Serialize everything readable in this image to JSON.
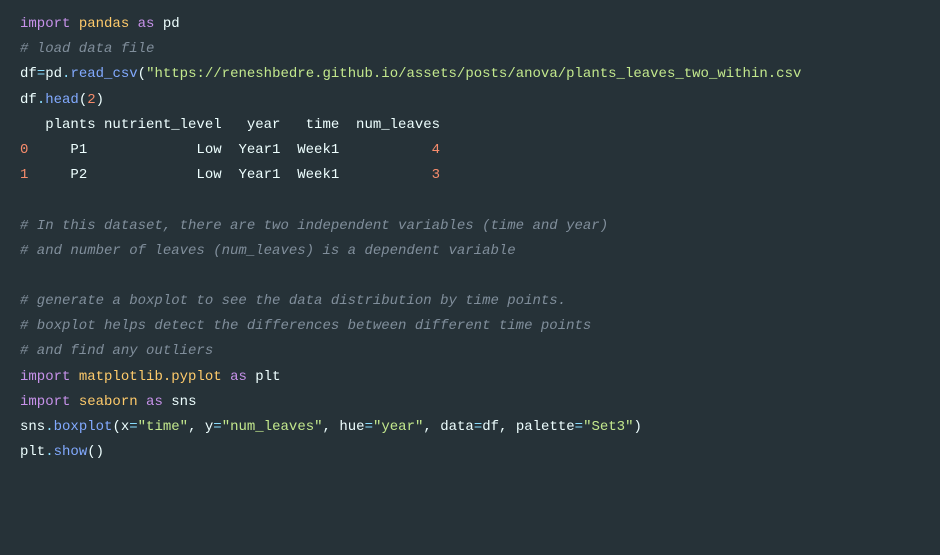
{
  "code": {
    "l1_import": "import",
    "l1_mod": "pandas",
    "l1_as": "as",
    "l1_alias": "pd",
    "l2_comment": "# load data file",
    "l3_var": "df",
    "l3_eq": "=",
    "l3_pd": "pd",
    "l3_dot": ".",
    "l3_fn": "read_csv",
    "l3_lp": "(",
    "l3_url": "\"https://reneshbedre.github.io/assets/posts/anova/plants_leaves_two_within.csv",
    "l4_var": "df",
    "l4_dot": ".",
    "l4_fn": "head",
    "l4_lp": "(",
    "l4_arg": "2",
    "l4_rp": ")",
    "tbl_header": "   plants nutrient_level   year   time  num_leaves",
    "tbl_r0_idx": "0",
    "tbl_r0_body": "     P1             Low  Year1  Week1           ",
    "tbl_r0_num": "4",
    "tbl_r1_idx": "1",
    "tbl_r1_body": "     P2             Low  Year1  Week1           ",
    "tbl_r1_num": "3",
    "c1": "# In this dataset, there are two independent variables (time and year)",
    "c2": "# and number of leaves (num_leaves) is a dependent variable",
    "c3": "# generate a boxplot to see the data distribution by time points.",
    "c4": "# boxplot helps detect the differences between different time points",
    "c5": "# and find any outliers",
    "l_imp2": "import",
    "l_mpl": "matplotlib.pyplot",
    "l_as2": "as",
    "l_plt": "plt",
    "l_imp3": "import",
    "l_sns_mod": "seaborn",
    "l_as3": "as",
    "l_sns": "sns",
    "bp_sns": "sns",
    "bp_dot": ".",
    "bp_fn": "boxplot",
    "bp_lp": "(",
    "bp_x": "x",
    "bp_eq": "=",
    "bp_x_val": "\"time\"",
    "bp_c1": ", ",
    "bp_y": "y",
    "bp_y_val": "\"num_leaves\"",
    "bp_c2": ", ",
    "bp_hue": "hue",
    "bp_hue_val": "\"year\"",
    "bp_c3": ", ",
    "bp_data": "data",
    "bp_data_val": "df",
    "bp_c4": ", ",
    "bp_pal": "palette",
    "bp_pal_val": "\"Set3\"",
    "bp_rp": ")",
    "sh_plt": "plt",
    "sh_dot": ".",
    "sh_fn": "show",
    "sh_lp": "(",
    "sh_rp": ")"
  }
}
